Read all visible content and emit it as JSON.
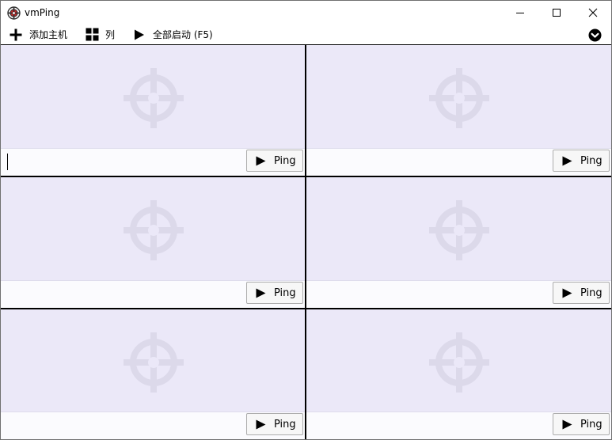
{
  "window": {
    "title": "vmPing"
  },
  "toolbar": {
    "add_host_label": "添加主机",
    "columns_label": "列",
    "start_all_label": "全部启动 (F5)"
  },
  "icons": {
    "app": "target-icon",
    "add": "plus-icon",
    "columns": "grid-icon",
    "start_all": "play-icon",
    "overflow": "chevron-down-circle-icon",
    "cell_placeholder": "crosshair-icon",
    "ping": "play-icon"
  },
  "colors": {
    "cell_background": "#ebe8f8",
    "crosshair": "#dcd9ea",
    "grid_lines": "#000000",
    "app_icon_red": "#c62828"
  },
  "cells": [
    {
      "host": "",
      "ping_label": "Ping",
      "focused": true
    },
    {
      "host": "",
      "ping_label": "Ping",
      "focused": false
    },
    {
      "host": "",
      "ping_label": "Ping",
      "focused": false
    },
    {
      "host": "",
      "ping_label": "Ping",
      "focused": false
    },
    {
      "host": "",
      "ping_label": "Ping",
      "focused": false
    },
    {
      "host": "",
      "ping_label": "Ping",
      "focused": false
    }
  ]
}
